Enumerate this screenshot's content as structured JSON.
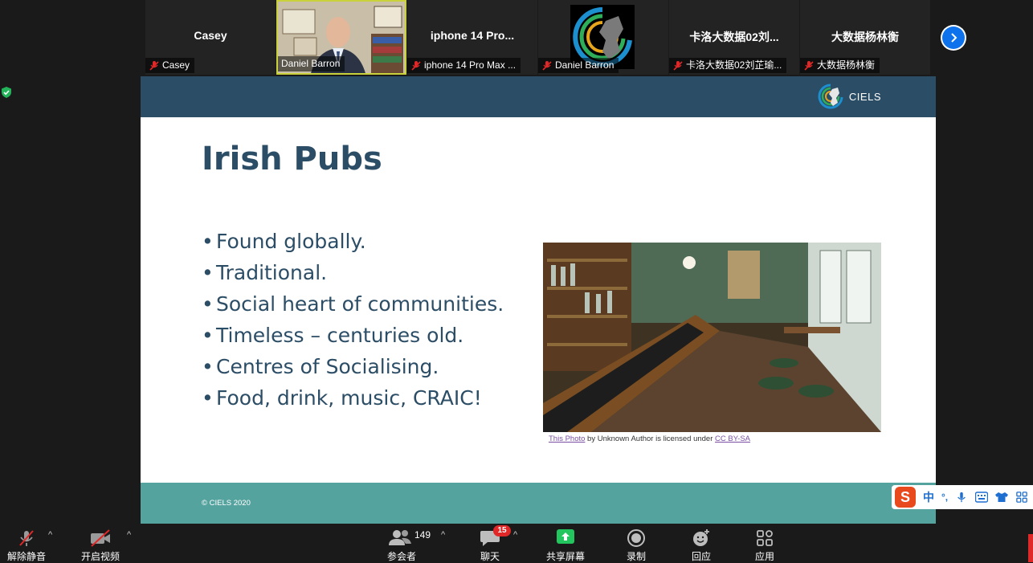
{
  "participants": [
    {
      "display": "Casey",
      "name": "Casey",
      "video": "none"
    },
    {
      "display": "",
      "name": "Daniel Barron",
      "video": "person",
      "speaking": true
    },
    {
      "display": "iphone 14 Pro...",
      "name": "iphone 14 Pro Max ...",
      "video": "none"
    },
    {
      "display": "",
      "name": "Daniel Barron",
      "video": "logo"
    },
    {
      "display": "卡洛大数据02刘...",
      "name": "卡洛大数据02刘芷瑜...",
      "video": "none"
    },
    {
      "display": "大数据杨林衡",
      "name": "大数据杨林衡",
      "video": "none"
    }
  ],
  "slide": {
    "logo_text": "CIELS",
    "title": "Irish Pubs",
    "bullets": [
      "Found globally.",
      "Traditional.",
      "Social heart of communities.",
      "Timeless – centuries old.",
      "Centres of Socialising.",
      "Food, drink, music, CRAIC!"
    ],
    "photo_credit": {
      "link1": "This Photo",
      "middle": " by Unknown Author is licensed under ",
      "link2": "CC BY-SA"
    },
    "copyright": "© CIELS 2020"
  },
  "toolbar": {
    "unmute": "解除静音",
    "start_video": "开启视频",
    "participants": "参会者",
    "participants_count": "149",
    "chat": "聊天",
    "chat_badge": "15",
    "share": "共享屏幕",
    "record": "录制",
    "reactions": "回应",
    "apps": "应用"
  },
  "ime": {
    "lang": "中",
    "punct": "°,"
  },
  "colors": {
    "slide_header": "#2c4d66",
    "slide_footer": "#55a39f",
    "speaker_border": "#c9d23a",
    "share_green": "#22c55e",
    "accent_blue": "#0e72ed"
  }
}
